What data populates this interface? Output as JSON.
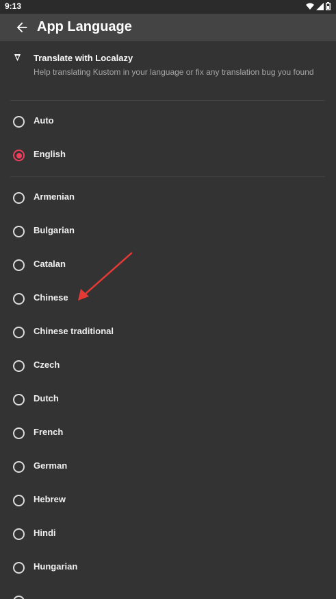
{
  "status_bar": {
    "time": "9:13"
  },
  "app_bar": {
    "title": "App Language"
  },
  "localazy": {
    "title": "Translate with Localazy",
    "subtitle": "Help translating Kustom in your language or fix any translation bug you found"
  },
  "top_options": [
    {
      "label": "Auto",
      "selected": false
    },
    {
      "label": "English",
      "selected": true
    }
  ],
  "languages": [
    {
      "label": "Armenian"
    },
    {
      "label": "Bulgarian"
    },
    {
      "label": "Catalan"
    },
    {
      "label": "Chinese"
    },
    {
      "label": "Chinese traditional"
    },
    {
      "label": "Czech"
    },
    {
      "label": "Dutch"
    },
    {
      "label": "French"
    },
    {
      "label": "German"
    },
    {
      "label": "Hebrew"
    },
    {
      "label": "Hindi"
    },
    {
      "label": "Hungarian"
    }
  ],
  "colors": {
    "accent": "#ee3e5b",
    "annotation_arrow": "#e53935"
  }
}
